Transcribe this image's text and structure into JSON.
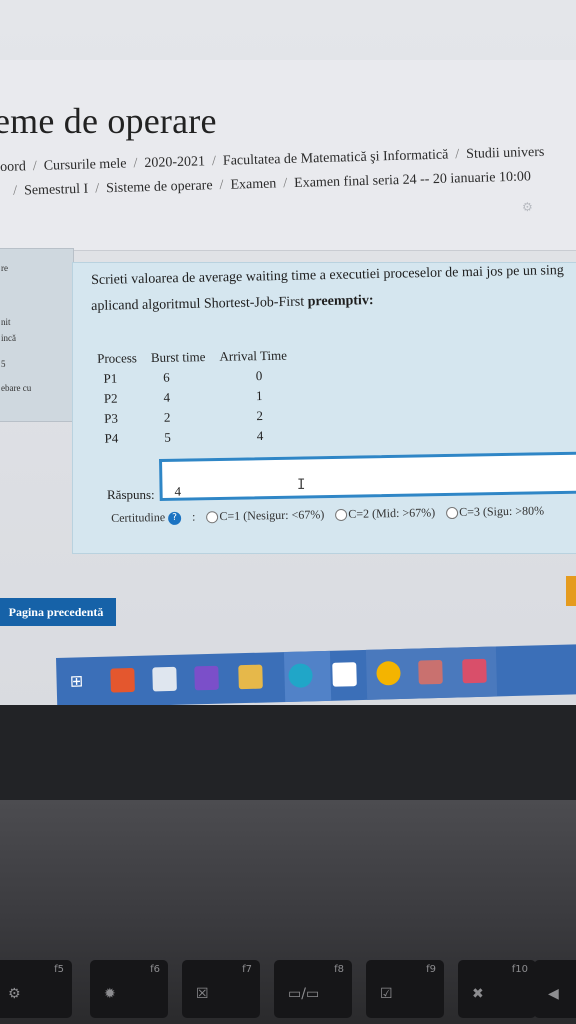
{
  "page": {
    "title": "eme de operare",
    "breadcrumbs_row1": [
      "oord",
      "Cursurile mele",
      "2020-2021",
      "Facultatea de Matematică şi Informatică",
      "Studii univers"
    ],
    "breadcrumbs_row2": [
      "",
      "Semestrul I",
      "Sisteme de operare",
      "Examen",
      "Examen final seria 24 -- 20 ianuarie 10:00"
    ]
  },
  "left_panel": [
    "re",
    "nit",
    "incă",
    "5",
    "ebare cu"
  ],
  "question": {
    "line1": "Scrieti valoarea de average waiting time a executiei proceselor de mai jos pe un sing",
    "line2_prefix": "aplicand algoritmul Shortest-Job-First ",
    "line2_bold": "preemptiv:",
    "table": {
      "headers": [
        "Process",
        "Burst time",
        "Arrival Time"
      ],
      "rows": [
        [
          "P1",
          "6",
          "0"
        ],
        [
          "P2",
          "4",
          "1"
        ],
        [
          "P3",
          "2",
          "2"
        ],
        [
          "P4",
          "5",
          "4"
        ]
      ]
    },
    "answer_label": "Răspuns:",
    "answer_value": "4",
    "cert_label": "Certitudine",
    "cert_options": [
      "C=1 (Nesigur: <67%)",
      "C=2 (Mid: >67%)",
      "C=3 (Sigu: >80%"
    ]
  },
  "nav": {
    "prev_label": "Pagina precedentă"
  },
  "keyboard": [
    "f5",
    "f6",
    "f7",
    "f8",
    "f9",
    "f10"
  ],
  "colors": {
    "accent": "#1662a8",
    "input_border": "#2f86c6",
    "taskbar": "#3b6fb8"
  }
}
